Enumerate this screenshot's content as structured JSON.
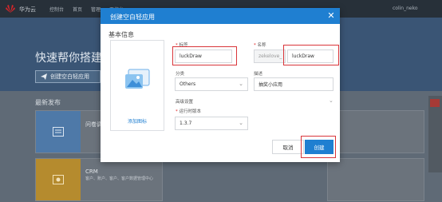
{
  "background": {
    "brand": "华为云",
    "nav": [
      "控制台",
      "首页",
      "管理",
      "工作台"
    ],
    "user": "colin_neko",
    "hero_title": "快速帮你搭建轻",
    "hero_button": "创建空白轻应用",
    "section_title": "最新发布",
    "cards": [
      {
        "title": "问卷调查",
        "desc": ""
      },
      {
        "title": "CRM",
        "desc": "客户、账户、客户、客户数据管理中心"
      }
    ]
  },
  "modal": {
    "title": "创建空白轻应用",
    "close": "✕",
    "section": "基本信息",
    "icon_label": "添加图标",
    "fields": {
      "tag_label": "标签",
      "tag_value": "luckDraw",
      "name_label": "名称",
      "name_prefix": "zekelove_",
      "name_value": "luckDraw",
      "category_label": "分类",
      "category_value": "Others",
      "desc_label": "描述",
      "desc_value": "抽奖小应用",
      "advanced_label": "高级设置",
      "runtime_label": "运行时版本",
      "runtime_value": "1.3.7"
    },
    "cancel": "取消",
    "create": "创建"
  },
  "colors": {
    "primary": "#1f7fd1",
    "highlight": "#d9353a",
    "required": "#e02020"
  }
}
